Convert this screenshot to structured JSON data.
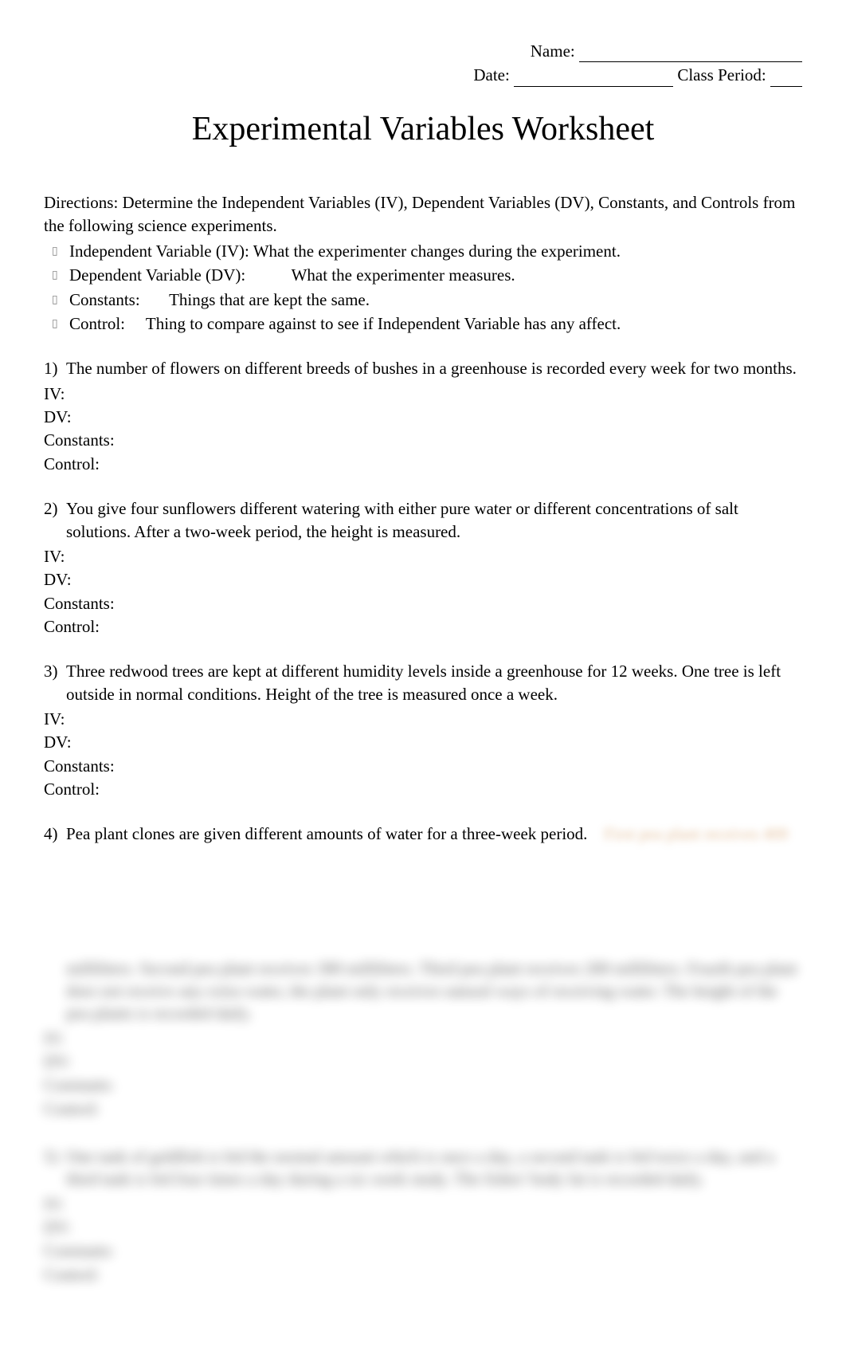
{
  "header": {
    "name_label": "Name:",
    "date_label": "Date:",
    "class_period_label": "Class Period:"
  },
  "title": "Experimental Variables Worksheet",
  "directions": "Directions: Determine the Independent Variables (IV), Dependent Variables (DV), Constants, and Controls from the following science experiments.",
  "definitions": [
    {
      "label": "Independent Variable (IV):",
      "desc": "What the experimenter changes during the experiment."
    },
    {
      "label": "Dependent Variable (DV):",
      "desc": "What the experimenter measures."
    },
    {
      "label": "Constants:",
      "desc": "Things that are kept the same."
    },
    {
      "label": "Control:",
      "desc": "Thing to compare against to see if Independent Variable has any affect."
    }
  ],
  "answer_labels": {
    "iv": "IV:",
    "dv": "DV:",
    "constants": "Constants:",
    "control": "Control:"
  },
  "questions": [
    {
      "num": "1)",
      "text": "The number of flowers on different breeds of bushes in a greenhouse is recorded every week for two months."
    },
    {
      "num": "2)",
      "text": "You give four sunflowers different watering with either pure water or different concentrations of salt solutions.  After a two-week period, the height is measured."
    },
    {
      "num": "3)",
      "text": "Three redwood trees are kept at different humidity levels inside a greenhouse for 12 weeks.  One tree is left outside in normal conditions.  Height of the tree is measured once a week."
    },
    {
      "num": "4)",
      "text": "Pea plant clones are given different amounts of water for a three-week period.",
      "hint": "First pea plant receives 400"
    }
  ],
  "blurred_questions": [
    {
      "continuation": "milliliters.  Second pea plant receives 300 milliliters.  Third pea plant receives 200 milliliters.  Fourth pea plant does not receive any extra water, the plant only receives natural ways of receiving water.  The height of the pea plants is recorded daily."
    },
    {
      "num": "5)",
      "text": "One tank of goldfish is fed the normal amount which is once a day, a second tank is fed twice a day, and a third tank is fed four times a day during a six week study.  The fishes' body fat is recorded daily."
    }
  ]
}
